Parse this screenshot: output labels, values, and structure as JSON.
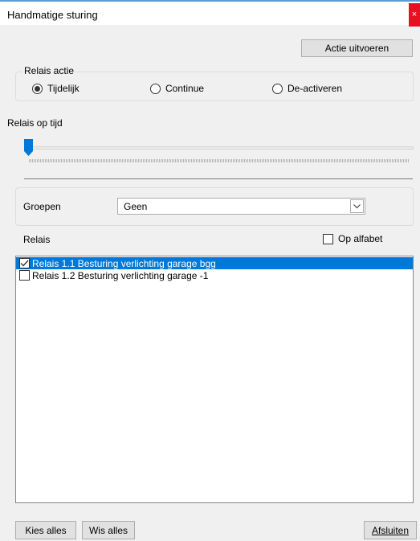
{
  "window": {
    "title": "Handmatige sturing",
    "close_glyph": "×"
  },
  "toolbar": {
    "execute_label": "Actie uitvoeren"
  },
  "relay_action": {
    "legend": "Relais actie",
    "options": [
      {
        "label": "Tijdelijk",
        "selected": true
      },
      {
        "label": "Continue",
        "selected": false
      },
      {
        "label": "De-activeren",
        "selected": false
      }
    ]
  },
  "relay_time": {
    "label": "Relais op tijd",
    "slider_value": 0
  },
  "groups": {
    "label": "Groepen",
    "selected": "Geen"
  },
  "relays": {
    "label": "Relais",
    "alphabetical_label": "Op alfabet",
    "alphabetical_checked": false,
    "items": [
      {
        "label": "Relais 1.1 Besturing verlichting garage bgg",
        "checked": true,
        "selected": true
      },
      {
        "label": "Relais 1.2 Besturing verlichting garage -1",
        "checked": false,
        "selected": false
      }
    ]
  },
  "footer": {
    "select_all_label": "Kies alles",
    "clear_all_label": "Wis alles",
    "close_label": "Afsluiten"
  },
  "colors": {
    "selection": "#0078d7",
    "slider_thumb": "#0078d7",
    "close_button": "#e81123"
  }
}
